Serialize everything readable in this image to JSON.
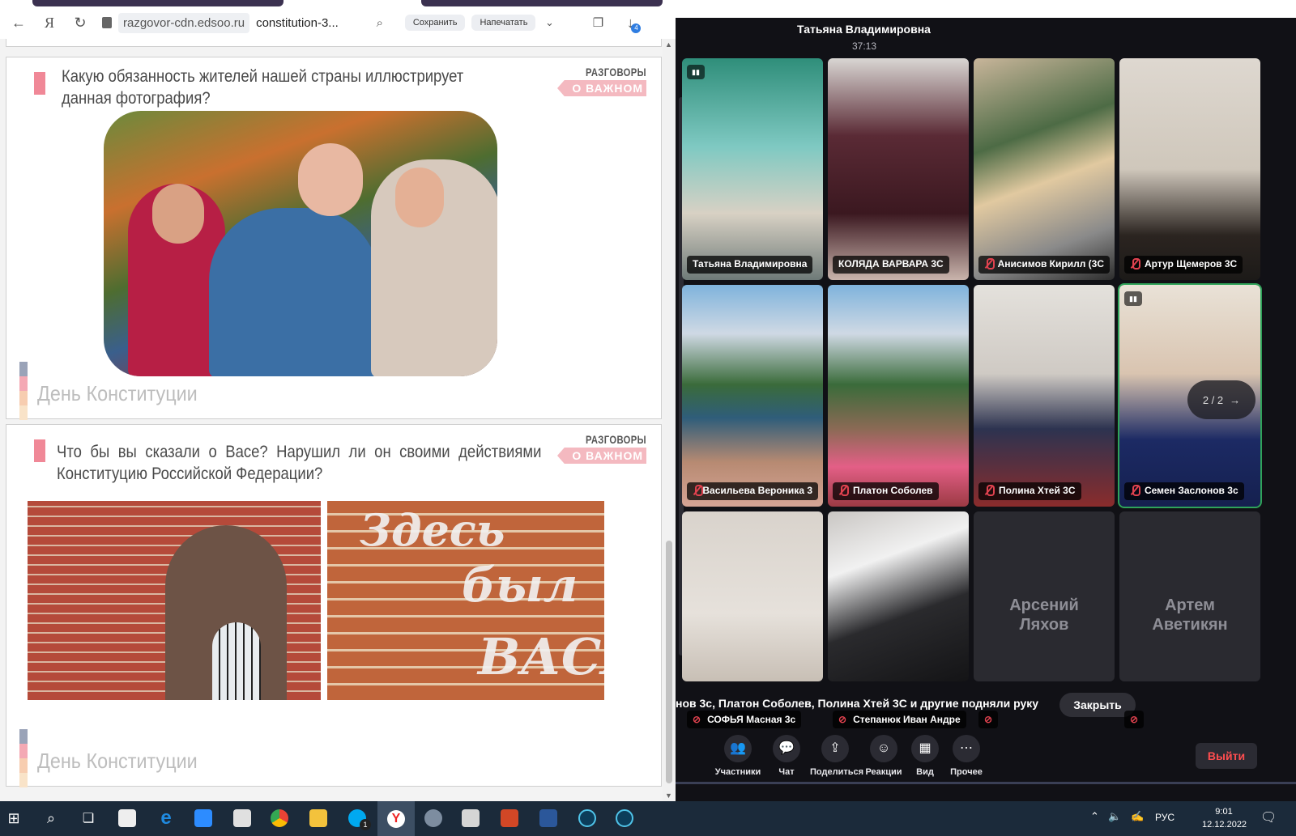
{
  "browser": {
    "address_domain": "razgovor-cdn.edsoo.ru",
    "address_path": "constitution-3...",
    "save_label": "Сохранить",
    "print_label": "Напечатать",
    "download_badge": "4"
  },
  "slides": [
    {
      "question": "Какую обязанность жителей нашей страны иллюстрирует данная фотография?",
      "brand_top": "РАЗГОВОРЫ",
      "brand_bottom": "О ВАЖНОМ",
      "footer": "День Конституции"
    },
    {
      "question": "Что бы вы сказали о Васе?   Нарушил ли он своими действиями Конституцию Российской Федерации?",
      "brand_top": "РАЗГОВОРЫ",
      "brand_bottom": "О ВАЖНОМ",
      "footer": "День Конституции"
    }
  ],
  "conference": {
    "host": "Татьяна Владимировна",
    "timer": "37:13",
    "tiles": [
      {
        "name": "Татьяна Владимировна",
        "muted": false,
        "signal": true
      },
      {
        "name": "КОЛЯДА ВАРВАРА 3С",
        "muted": false
      },
      {
        "name": "Анисимов Кирилл (3С",
        "muted": true
      },
      {
        "name": "Артур Щемеров 3С",
        "muted": true
      },
      {
        "name": "Васильева Вероника 3",
        "muted": true
      },
      {
        "name": "Платон Соболев",
        "muted": true
      },
      {
        "name": "Полина Хтей 3С",
        "muted": true
      },
      {
        "name": "Семен Заслонов 3с",
        "muted": true,
        "signal": true,
        "active": true
      },
      {
        "name": "СОФЬЯ Масная 3с",
        "muted": true
      },
      {
        "name": "Степанюк Иван Андре",
        "muted": true
      },
      {
        "name": "Арсений Ляхов",
        "muted": true
      },
      {
        "name": "Артем Аветикян",
        "muted": true
      }
    ],
    "pager": "2 / 2",
    "raised_hands": "нов 3с, Платон Соболев, Полина Хтей 3С и другие подняли руку",
    "close_label": "Закрыть",
    "controls": [
      {
        "label": "Участники",
        "icon": "participants-icon"
      },
      {
        "label": "Чат",
        "icon": "chat-icon"
      },
      {
        "label": "Поделиться",
        "icon": "share-icon"
      },
      {
        "label": "Реакции",
        "icon": "reactions-icon"
      },
      {
        "label": "Вид",
        "icon": "view-icon"
      },
      {
        "label": "Прочее",
        "icon": "more-icon"
      }
    ],
    "leave_label": "Выйти"
  },
  "taskbar": {
    "lang": "РУС",
    "time": "9:01",
    "date": "12.12.2022",
    "skype_badge": "1"
  },
  "graffiti": {
    "l1": "Здесь",
    "l2": "был",
    "l3": "ВАСЯ!"
  }
}
